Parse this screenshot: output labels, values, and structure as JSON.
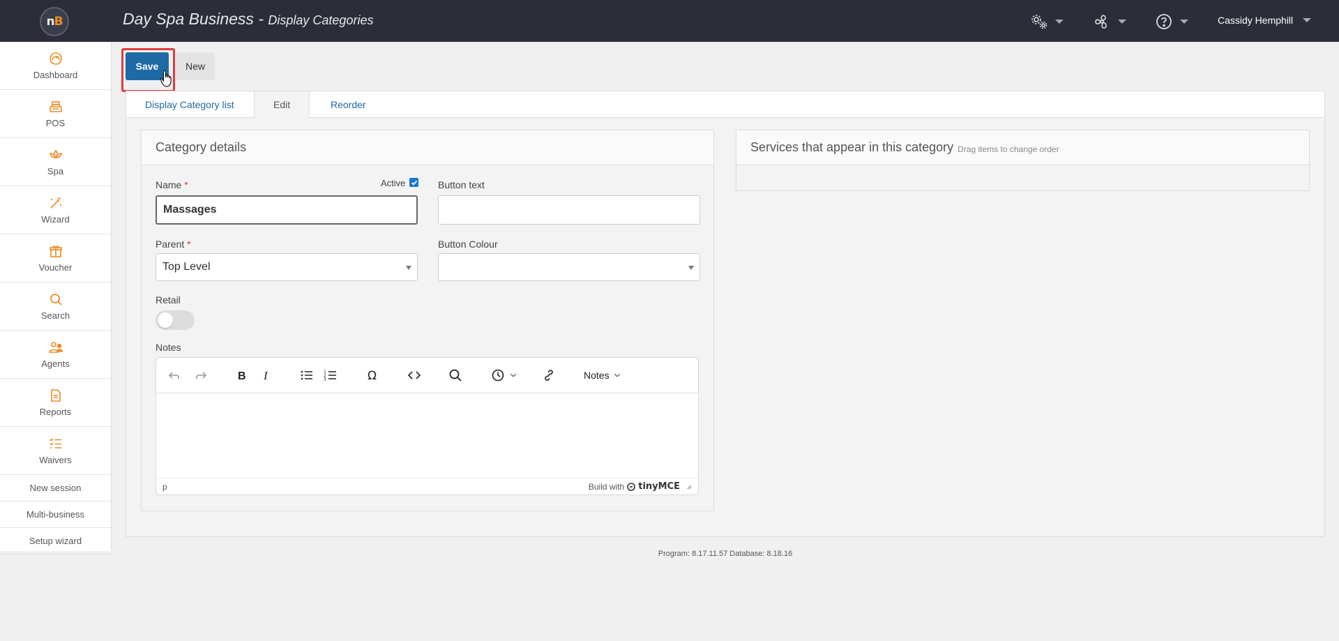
{
  "app": {
    "business": "Day Spa Business",
    "separator": " - ",
    "page": "Display Categories",
    "logo_n": "n",
    "logo_b": "B"
  },
  "topbar": {
    "user_name": "Cassidy Hemphill",
    "icons": [
      "settings-gears-icon",
      "fan-icon",
      "help-icon"
    ]
  },
  "sidebar": {
    "items": [
      {
        "label": "Dashboard",
        "icon": "dashboard-icon"
      },
      {
        "label": "POS",
        "icon": "cash-register-icon"
      },
      {
        "label": "Spa",
        "icon": "lotus-icon"
      },
      {
        "label": "Wizard",
        "icon": "magic-wand-icon"
      },
      {
        "label": "Voucher",
        "icon": "gift-icon"
      },
      {
        "label": "Search",
        "icon": "search-icon"
      },
      {
        "label": "Agents",
        "icon": "agents-icon"
      },
      {
        "label": "Reports",
        "icon": "report-icon"
      },
      {
        "label": "Waivers",
        "icon": "checklist-icon"
      }
    ],
    "links": [
      "New session",
      "Multi-business",
      "Setup wizard"
    ]
  },
  "toolbar": {
    "save_label": "Save",
    "new_label": "New"
  },
  "tabs": [
    {
      "label": "Display Category list",
      "active": false
    },
    {
      "label": "Edit",
      "active": true
    },
    {
      "label": "Reorder",
      "active": false
    }
  ],
  "category_details": {
    "title": "Category details",
    "name_label": "Name",
    "required_mark": "*",
    "active_label": "Active",
    "active_checked": true,
    "name_value": "Massages",
    "button_text_label": "Button text",
    "button_text_value": "",
    "parent_label": "Parent",
    "parent_value": "Top Level",
    "button_colour_label": "Button Colour",
    "button_colour_value": "",
    "retail_label": "Retail",
    "retail_on": false,
    "notes_label": "Notes",
    "editor": {
      "styles_dropdown": "Notes",
      "status_path": "p",
      "brand_prefix": "Build with",
      "brand_name": "tinyMCE"
    }
  },
  "services": {
    "title": "Services that appear in this category",
    "hint": "Drag items to change order"
  },
  "footer": {
    "version": "Program: 8.17.11.57 Database: 8.18.16"
  },
  "colors": {
    "topbar": "#2b2e38",
    "accent_orange": "#f08a24",
    "primary_blue": "#1e6aa5",
    "highlight_red": "#e03c3c"
  }
}
